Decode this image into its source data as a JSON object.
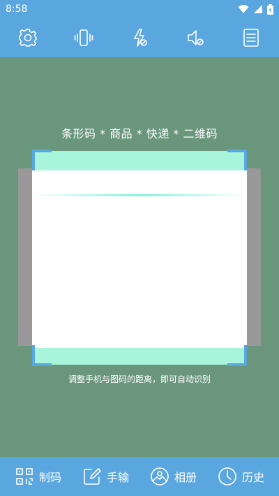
{
  "status_bar": {
    "time": "8:58"
  },
  "toolbar": {
    "items": [
      {
        "icon": "settings-icon"
      },
      {
        "icon": "vibrate-icon"
      },
      {
        "icon": "flash-off-icon"
      },
      {
        "icon": "sound-off-icon"
      },
      {
        "icon": "document-icon"
      }
    ]
  },
  "scanner": {
    "top_hint": "条形码 * 商品 * 快递 * 二维码",
    "bottom_hint": "调整手机与图码的距离，即可自动识别"
  },
  "bottom_nav": {
    "items": [
      {
        "label": "制码",
        "icon": "qr-code-icon"
      },
      {
        "label": "手输",
        "icon": "edit-icon"
      },
      {
        "label": "相册",
        "icon": "gallery-icon"
      },
      {
        "label": "历史",
        "icon": "history-icon"
      }
    ]
  },
  "colors": {
    "bar": "#5aa6df",
    "background": "#6a967c",
    "scan_band": "#a9f5dc"
  }
}
